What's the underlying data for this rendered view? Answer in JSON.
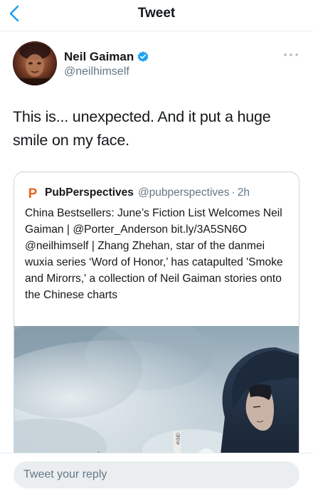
{
  "nav": {
    "title": "Tweet"
  },
  "tweet": {
    "author_name": "Neil Gaiman",
    "author_handle": "@neilhimself",
    "verified": true,
    "text": "This is... unexpected. And it put a huge smile on my face."
  },
  "quoted_tweet": {
    "logo_letter": "P",
    "author_name": "PubPerspectives",
    "author_handle": "@pubperspectives",
    "separator": "·",
    "time": "2h",
    "text": "China Bestsellers: June’s Fiction List Welcomes Neil Gaiman | @Porter_Anderson bit.ly/3A5SN6O @neilhimself | Zhang Zhehan, star of the danmei wuxia series ‘Word of Honor,’ has catapulted 'Smoke and Mirorrs,' a collection of Neil Gaiman stories onto the Chinese charts",
    "image_seal_text": "山河令"
  },
  "reply": {
    "placeholder": "Tweet your reply"
  },
  "colors": {
    "accent": "#1da1f2",
    "secondary_text": "#657786",
    "logo_orange": "#e8641b"
  },
  "icons": {
    "back": "chevron-left-icon",
    "verified": "verified-badge-icon",
    "more": "more-horizontal-icon"
  }
}
